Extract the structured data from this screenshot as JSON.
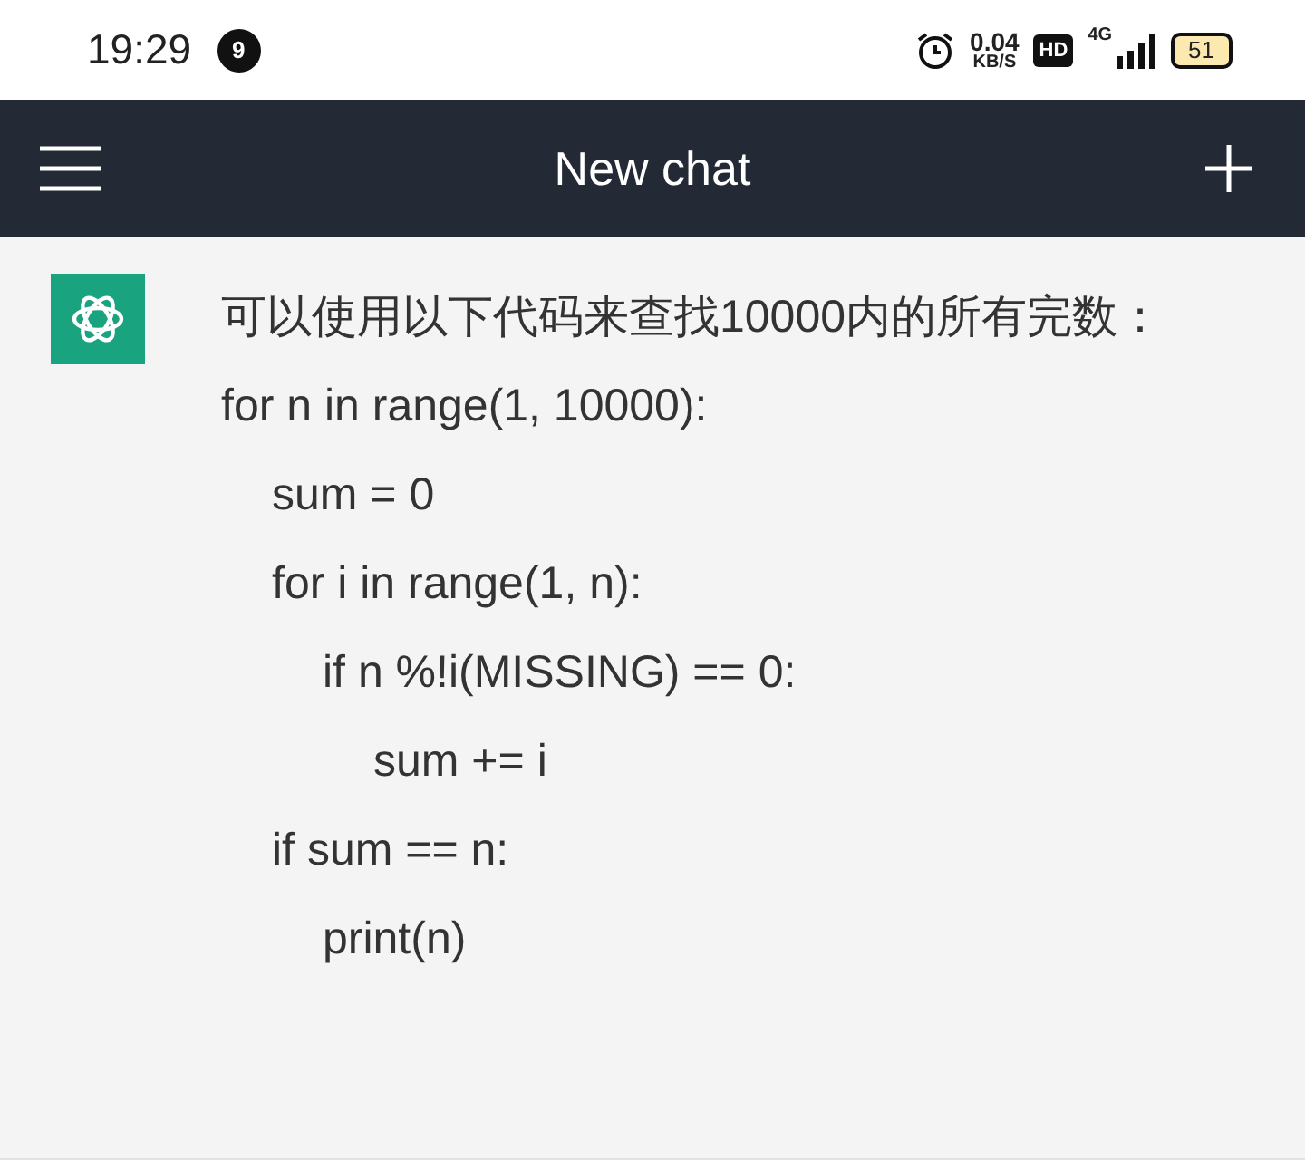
{
  "status_bar": {
    "time": "19:29",
    "notification_count": "9",
    "net_speed": "0.04",
    "net_unit": "KB/S",
    "hd": "HD",
    "network": "4G",
    "battery": "51"
  },
  "header": {
    "title": "New chat"
  },
  "message": {
    "text": "可以使用以下代码来查找10000内的所有完数：",
    "code": [
      {
        "text": "for n in range(1, 10000):",
        "children": [
          {
            "text": "sum = 0"
          },
          {
            "text": "for i in range(1, n):",
            "children": [
              {
                "text": "if n %!i(MISSING) == 0:",
                "children": [
                  {
                    "text": "sum += i"
                  }
                ]
              }
            ]
          },
          {
            "text": "if sum == n:",
            "children": [
              {
                "text": "print(n)"
              }
            ]
          }
        ]
      }
    ]
  }
}
